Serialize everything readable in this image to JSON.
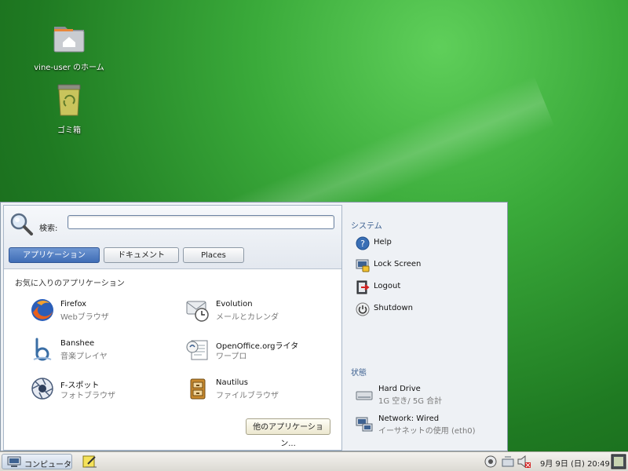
{
  "desktop": {
    "icons": [
      {
        "label": "vine-user のホーム",
        "icon": "home-folder-icon"
      },
      {
        "label": "ゴミ箱",
        "icon": "trash-icon"
      }
    ]
  },
  "menu": {
    "search": {
      "label": "検索:",
      "value": ""
    },
    "tabs": [
      "アプリケーション",
      "ドキュメント",
      "Places"
    ],
    "active_tab": "アプリケーション",
    "favorites_title": "お気に入りのアプリケーション",
    "apps": [
      {
        "name": "Firefox",
        "desc": "Webブラウザ",
        "icon": "firefox-icon"
      },
      {
        "name": "Evolution",
        "desc": "メールとカレンダ",
        "icon": "evolution-icon"
      },
      {
        "name": "Banshee",
        "desc": "音楽プレイヤ",
        "icon": "banshee-icon"
      },
      {
        "name": "OpenOffice.orgライタ",
        "desc": "ワープロ",
        "icon": "writer-icon"
      },
      {
        "name": "F-スポット",
        "desc": "フォトブラウザ",
        "icon": "f-spot-icon"
      },
      {
        "name": "Nautilus",
        "desc": "ファイルブラウザ",
        "icon": "nautilus-icon"
      }
    ],
    "more_apps_label": "他のアプリケーション...",
    "system": {
      "title": "システム",
      "items": [
        {
          "label": "Help",
          "icon": "help-icon"
        },
        {
          "label": "Lock Screen",
          "icon": "lock-screen-icon"
        },
        {
          "label": "Logout",
          "icon": "logout-icon"
        },
        {
          "label": "Shutdown",
          "icon": "shutdown-icon"
        }
      ]
    },
    "status": {
      "title": "状態",
      "items": [
        {
          "label": "Hard Drive",
          "sub": "1G 空き/ 5G 合計",
          "icon": "hard-drive-icon"
        },
        {
          "label": "Network: Wired",
          "sub": "イーサネットの使用 (eth0)",
          "icon": "network-icon"
        }
      ]
    }
  },
  "panel": {
    "computer_label": "コンピュータ",
    "clock": "9月 9日 (日) 20:49"
  },
  "colors": {
    "accent": "#3f6db6",
    "desktop": "#2f8f30"
  }
}
